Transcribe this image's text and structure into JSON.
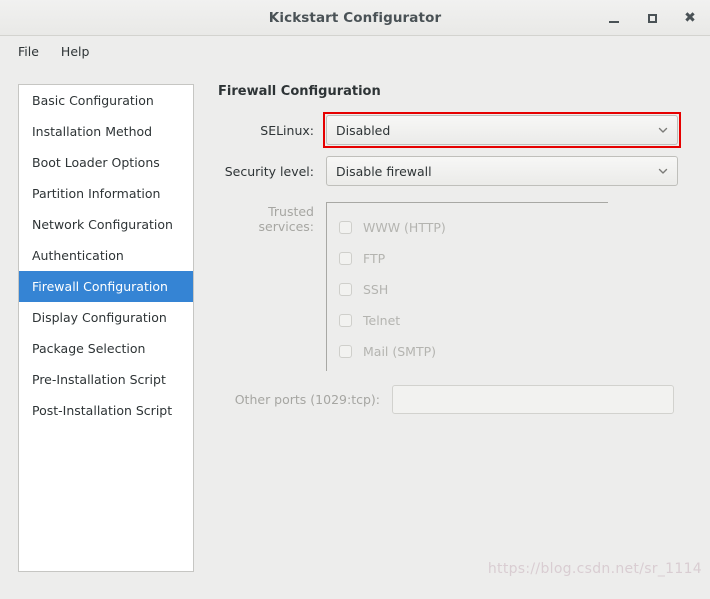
{
  "window": {
    "title": "Kickstart Configurator",
    "controls": {
      "minimize": "minimize-icon",
      "maximize": "maximize-icon",
      "close": "close-icon"
    }
  },
  "menubar": {
    "items": [
      {
        "label": "File"
      },
      {
        "label": "Help"
      }
    ]
  },
  "sidebar": {
    "items": [
      {
        "label": "Basic Configuration",
        "selected": false
      },
      {
        "label": "Installation Method",
        "selected": false
      },
      {
        "label": "Boot Loader Options",
        "selected": false
      },
      {
        "label": "Partition Information",
        "selected": false
      },
      {
        "label": "Network Configuration",
        "selected": false
      },
      {
        "label": "Authentication",
        "selected": false
      },
      {
        "label": "Firewall Configuration",
        "selected": true
      },
      {
        "label": "Display Configuration",
        "selected": false
      },
      {
        "label": "Package Selection",
        "selected": false
      },
      {
        "label": "Pre-Installation Script",
        "selected": false
      },
      {
        "label": "Post-Installation Script",
        "selected": false
      }
    ]
  },
  "main": {
    "panel_title": "Firewall Configuration",
    "selinux": {
      "label": "SELinux:",
      "value": "Disabled",
      "highlight_color": "#e60000"
    },
    "security_level": {
      "label": "Security level:",
      "value": "Disable firewall"
    },
    "trusted_services": {
      "label": "Trusted services:",
      "items": [
        {
          "label": "WWW (HTTP)",
          "checked": false
        },
        {
          "label": "FTP",
          "checked": false
        },
        {
          "label": "SSH",
          "checked": false
        },
        {
          "label": "Telnet",
          "checked": false
        },
        {
          "label": "Mail (SMTP)",
          "checked": false
        }
      ]
    },
    "other_ports": {
      "label": "Other ports (1029:tcp):",
      "value": "",
      "placeholder": ""
    }
  },
  "watermark": {
    "text": "https://blog.csdn.net/sr_1114"
  },
  "theme": {
    "accent": "#3584d4",
    "background": "#ededec",
    "text": "#2e3436",
    "disabled_text": "#b4b4b0"
  }
}
